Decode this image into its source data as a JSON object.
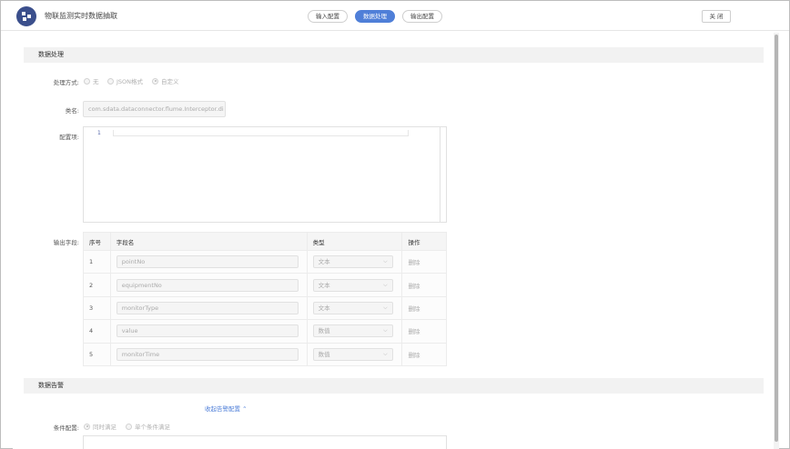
{
  "header": {
    "title": "物联监测实时数据抽取",
    "steps": [
      "输入配置",
      "数据处理",
      "输出配置"
    ],
    "close_label": "关 闭",
    "accent_color": "#4f7fd8"
  },
  "processing": {
    "section_title": "数据处理",
    "method_label": "处理方式:",
    "method_options": [
      "无",
      "JSON格式",
      "自定义"
    ],
    "class_label": "类名:",
    "class_value": "com.sdata.dataconnector.flume.Interceptor.di",
    "config_label": "配置项:",
    "editor_line_number": "1",
    "output_label": "输出字段:",
    "table": {
      "headers": [
        "序号",
        "字段名",
        "类型",
        "操作"
      ],
      "rows": [
        {
          "no": "1",
          "field": "pointNo",
          "type": "文本",
          "action": "删除"
        },
        {
          "no": "2",
          "field": "equipmentNo",
          "type": "文本",
          "action": "删除"
        },
        {
          "no": "3",
          "field": "monitorType",
          "type": "文本",
          "action": "删除"
        },
        {
          "no": "4",
          "field": "value",
          "type": "数值",
          "action": "删除"
        },
        {
          "no": "5",
          "field": "monitorTime",
          "type": "数值",
          "action": "删除"
        }
      ]
    }
  },
  "alert": {
    "section_title": "数据告警",
    "collapse_label": "收起告警配置",
    "condition_label": "条件配置:",
    "condition_options": [
      "同时满足",
      "单个条件满足"
    ]
  }
}
